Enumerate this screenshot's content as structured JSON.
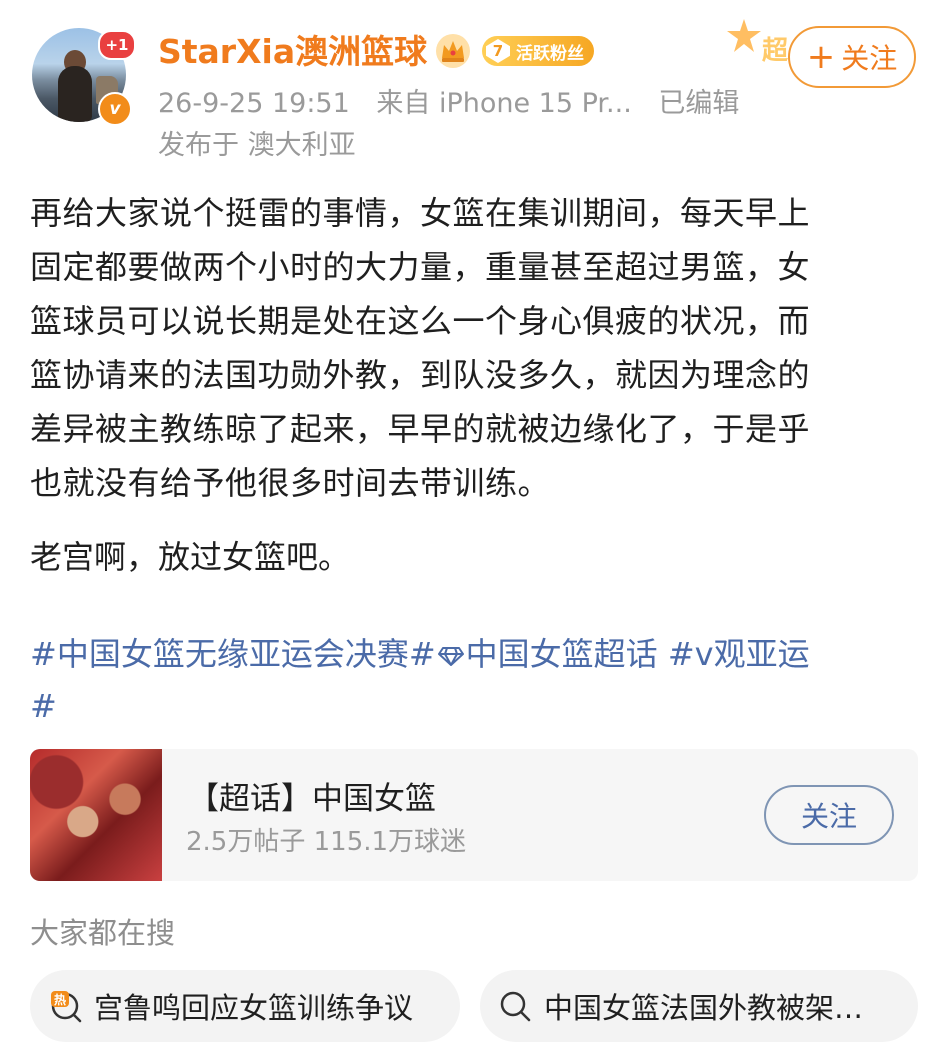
{
  "post": {
    "username": "StarXia澳洲篮球",
    "notification_badge": "+1",
    "fan_badge_level": "7",
    "fan_badge_label": "活跃粉丝",
    "super_deco_label": "超",
    "follow_label": "关注",
    "time": "26-9-25 19:51",
    "source": "来自 iPhone 15 Pr...",
    "edited": "已编辑",
    "location": "发布于 澳大利亚",
    "body_lines": [
      "再给大家说个挺雷的事情，女篮在集训期间，每天早上",
      "固定都要做两个小时的大力量，重量甚至超过男篮，女",
      "篮球员可以说长期是处在这么一个身心俱疲的状况，而",
      "篮协请来的法国功勋外教，到队没多久，就因为理念的",
      "差异被主教练晾了起来，早早的就被边缘化了，于是乎",
      "也就没有给予他很多时间去带训练。"
    ],
    "body_para2": "老宫啊，放过女篮吧。",
    "tags": {
      "tag1": "#中国女篮无缘亚运会决赛#",
      "tag2": "中国女篮超话",
      "tag3": "#v观亚运",
      "tag3_end": "#"
    }
  },
  "topic_card": {
    "title": "【超话】中国女篮",
    "stats": "2.5万帖子 115.1万球迷",
    "follow_label": "关注"
  },
  "search": {
    "label": "大家都在搜",
    "items": [
      {
        "text": "宫鲁鸣回应女篮训练争议",
        "icon": "hot-search-icon"
      },
      {
        "text": "中国女篮法国外教被架…",
        "icon": "search-icon"
      }
    ]
  },
  "colors": {
    "username": "#f07b1d",
    "link": "#4b6ba8",
    "muted": "#9a9a9a",
    "badge_red": "#e94040",
    "verified_orange": "#f28c1a"
  }
}
